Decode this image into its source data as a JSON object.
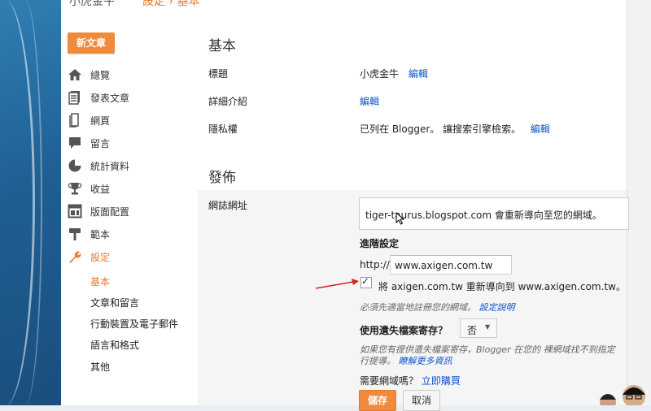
{
  "topbar": {
    "blog_name": "小虎金牛",
    "crumb": "設定 › 基本"
  },
  "sidebar": {
    "new_post": "新文章",
    "items": [
      {
        "label": "總覽",
        "icon": "home-icon"
      },
      {
        "label": "發表文章",
        "icon": "posts-icon"
      },
      {
        "label": "網頁",
        "icon": "pages-icon"
      },
      {
        "label": "留言",
        "icon": "comments-icon"
      },
      {
        "label": "統計資料",
        "icon": "stats-icon"
      },
      {
        "label": "收益",
        "icon": "trophy-icon"
      },
      {
        "label": "版面配置",
        "icon": "layout-icon"
      },
      {
        "label": "範本",
        "icon": "template-icon"
      },
      {
        "label": "設定",
        "icon": "wrench-icon"
      }
    ],
    "subitems": [
      "基本",
      "文章和留言",
      "行動裝置及電子郵件",
      "語言和格式",
      "其他"
    ]
  },
  "basic": {
    "title": "基本",
    "rows": [
      {
        "label": "標題",
        "value": "小虎金牛",
        "action": "編輯"
      },
      {
        "label": "詳細介紹",
        "value": "",
        "action": "編輯"
      },
      {
        "label": "隱私權",
        "value": "已列在 Blogger。 讓搜索引擎檢索。",
        "action": "編輯"
      }
    ]
  },
  "publish": {
    "title": "發佈",
    "address_label": "網誌網址",
    "address_text": "tiger-taurus.blogspot.com 會重新導向至您的網域。",
    "advanced_label": "進階設定",
    "http_prefix": "http://",
    "domain_value": "www.axigen.com.tw",
    "redirect_text": "將 axigen.com.tw 重新導向到 www.axigen.com.tw。",
    "dns_note": "必須先適當地註冊您的網域。",
    "setup_link": "設定說明",
    "missing_files_label": "使用遺失檔案寄存？",
    "missing_files_value": "否",
    "missing_note_1": "如果您有提供遺失檔案寄存，Blogger 在您的 裸網域找不到指定",
    "missing_note_2": "行提導。",
    "learn_more": "瞭解更多資訊",
    "need_domain": "需要網域嗎？",
    "buy_now": "立即購買",
    "save": "儲存",
    "cancel": "取消"
  },
  "colors": {
    "accent": "#f08a3c",
    "link": "#1155cc",
    "arrow": "#d22222"
  }
}
